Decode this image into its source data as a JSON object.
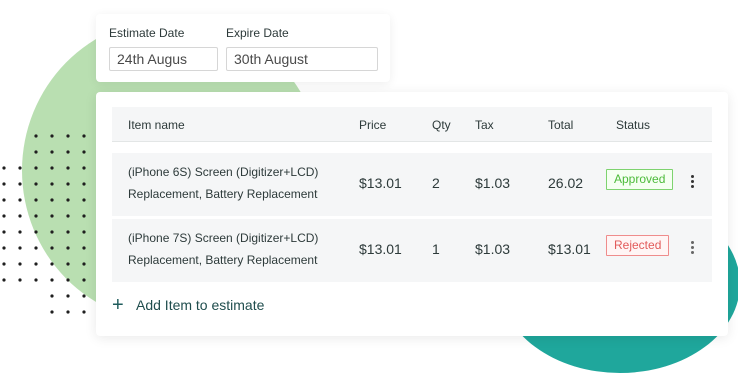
{
  "dates": {
    "estimate_label": "Estimate Date",
    "estimate_value": "24th Augus",
    "expire_label": "Expire Date",
    "expire_value": "30th August"
  },
  "table": {
    "headers": {
      "item": "Item name",
      "price": "Price",
      "qty": "Qty",
      "tax": "Tax",
      "total": "Total",
      "status": "Status"
    },
    "rows": [
      {
        "name_line1": "(iPhone 6S) Screen (Digitizer+LCD)",
        "name_line2": "Replacement, Battery Replacement",
        "price": "$13.01",
        "qty": "2",
        "tax": "$1.03",
        "total": "26.02",
        "status": "Approved"
      },
      {
        "name_line1": "(iPhone 7S) Screen (Digitizer+LCD)",
        "name_line2": "Replacement, Battery Replacement",
        "price": "$13.01",
        "qty": "1",
        "tax": "$1.03",
        "total": "$13.01",
        "status": "Rejected"
      }
    ]
  },
  "add_item": {
    "icon": "plus-icon",
    "label": "Add Item to estimate"
  },
  "colors": {
    "approved": "#4cbb3a",
    "rejected": "#e25a5a",
    "blob_green": "#b9dfb1",
    "blob_teal": "#1fa79c"
  }
}
